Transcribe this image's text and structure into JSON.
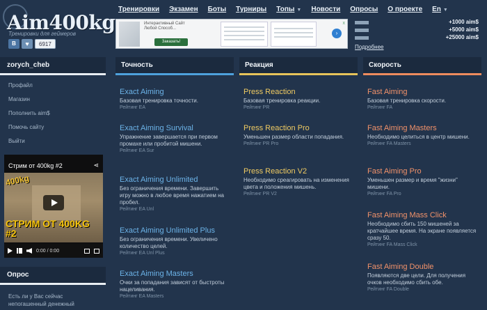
{
  "site": {
    "logo": "Aim400kg",
    "tagline": "Тренировки для геймеров",
    "social": {
      "vk": "В",
      "like_icon": "heart-icon",
      "count": "6917"
    }
  },
  "nav": [
    {
      "label": "Тренировки",
      "caret": false
    },
    {
      "label": "Экзамен",
      "caret": false
    },
    {
      "label": "Боты",
      "caret": false
    },
    {
      "label": "Турниры",
      "caret": false
    },
    {
      "label": "Топы",
      "caret": true
    },
    {
      "label": "Новости",
      "caret": false
    },
    {
      "label": "Опросы",
      "caret": false
    },
    {
      "label": "О проекте",
      "caret": false
    },
    {
      "label": "En",
      "caret": true
    }
  ],
  "ad": {
    "headline": "Интерактивный Сайт Любой Способ...",
    "button": "Заказать!",
    "close": "x",
    "arrow": "›"
  },
  "stats": {
    "rows": [
      "+1000 aim$",
      "+5000 aim$",
      "+25000 aim$"
    ],
    "link": "Подробнее"
  },
  "sidebar": {
    "username": "zorych_cheb",
    "menu": [
      "Профайл",
      "Магазин",
      "Пополнить aim$",
      "Помочь сайту",
      "Выйти"
    ],
    "video": {
      "title": "Стрим от 400kg #2",
      "badge": "400kg",
      "overlay": "СТРИМ ОТ 400KG #2",
      "time": "0:00 / 0:00"
    },
    "poll": {
      "heading": "Опрос",
      "text": "Есть ли у Вас сейчас непогашенный денежный"
    }
  },
  "columns": [
    {
      "heading": "Точность",
      "accent": "#4ea1dc",
      "title_color": "#6cb3e8",
      "cards": [
        {
          "title": "Exact Aiming",
          "desc": "Базовая тренировка точности.",
          "rating": "Рейтинг EA"
        },
        {
          "title": "Exact Aiming Survival",
          "desc": "Упражнение завершается при первом промахе или пробитой мишени.",
          "rating": "Рейтинг EA Sur"
        },
        {
          "title": "Exact Aiming Unlimited",
          "desc": "Без ограничения времени. Завершить игру можно в любое время нажатием на пробел.",
          "rating": "Рейтинг EA Unl"
        },
        {
          "title": "Exact Aiming Unlimited Plus",
          "desc": "Без ограничения времени. Увеличено количество целей.",
          "rating": "Рейтинг EA Unl Plus"
        },
        {
          "title": "Exact Aiming Masters",
          "desc": "Очки за попадания зависят от быстроты нацеливания.",
          "rating": "Рейтинг EA Masters"
        }
      ]
    },
    {
      "heading": "Реакция",
      "accent": "#e7c45a",
      "title_color": "#f0cb62",
      "cards": [
        {
          "title": "Press Reaction",
          "desc": "Базовая тренировка реакции.",
          "rating": "Рейтинг PR"
        },
        {
          "title": "Press Reaction Pro",
          "desc": "Уменьшен размер области попадания.",
          "rating": "Рейтинг PR Pro"
        },
        {
          "title": "Press Reaction V2",
          "desc": "Необходимо среагировать на изменения цвета и положения мишень.",
          "rating": "Рейтинг PR V2"
        }
      ]
    },
    {
      "heading": "Скорость",
      "accent": "#ef8c5e",
      "title_color": "#f2926a",
      "cards": [
        {
          "title": "Fast Aiming",
          "desc": "Базовая тренировка скорости.",
          "rating": "Рейтинг FA"
        },
        {
          "title": "Fast Aiming Masters",
          "desc": "Необходимо целиться в центр мишени.",
          "rating": "Рейтинг FA Masters"
        },
        {
          "title": "Fast Aiming Pro",
          "desc": "Уменьшен размер и время \"жизни\" мишени.",
          "rating": "Рейтинг FA Pro"
        },
        {
          "title": "Fast Aiming Mass Click",
          "desc": "Необходимо сбить 150 мишеней за кратчайшее время. На экране появляется сразу 50.",
          "rating": "Рейтинг FA Mass Click"
        },
        {
          "title": "Fast Aiming Double",
          "desc": "Появляются две цели. Для получения очков необходимо сбить обе.",
          "rating": "Рейтинг FA Double"
        }
      ]
    }
  ]
}
